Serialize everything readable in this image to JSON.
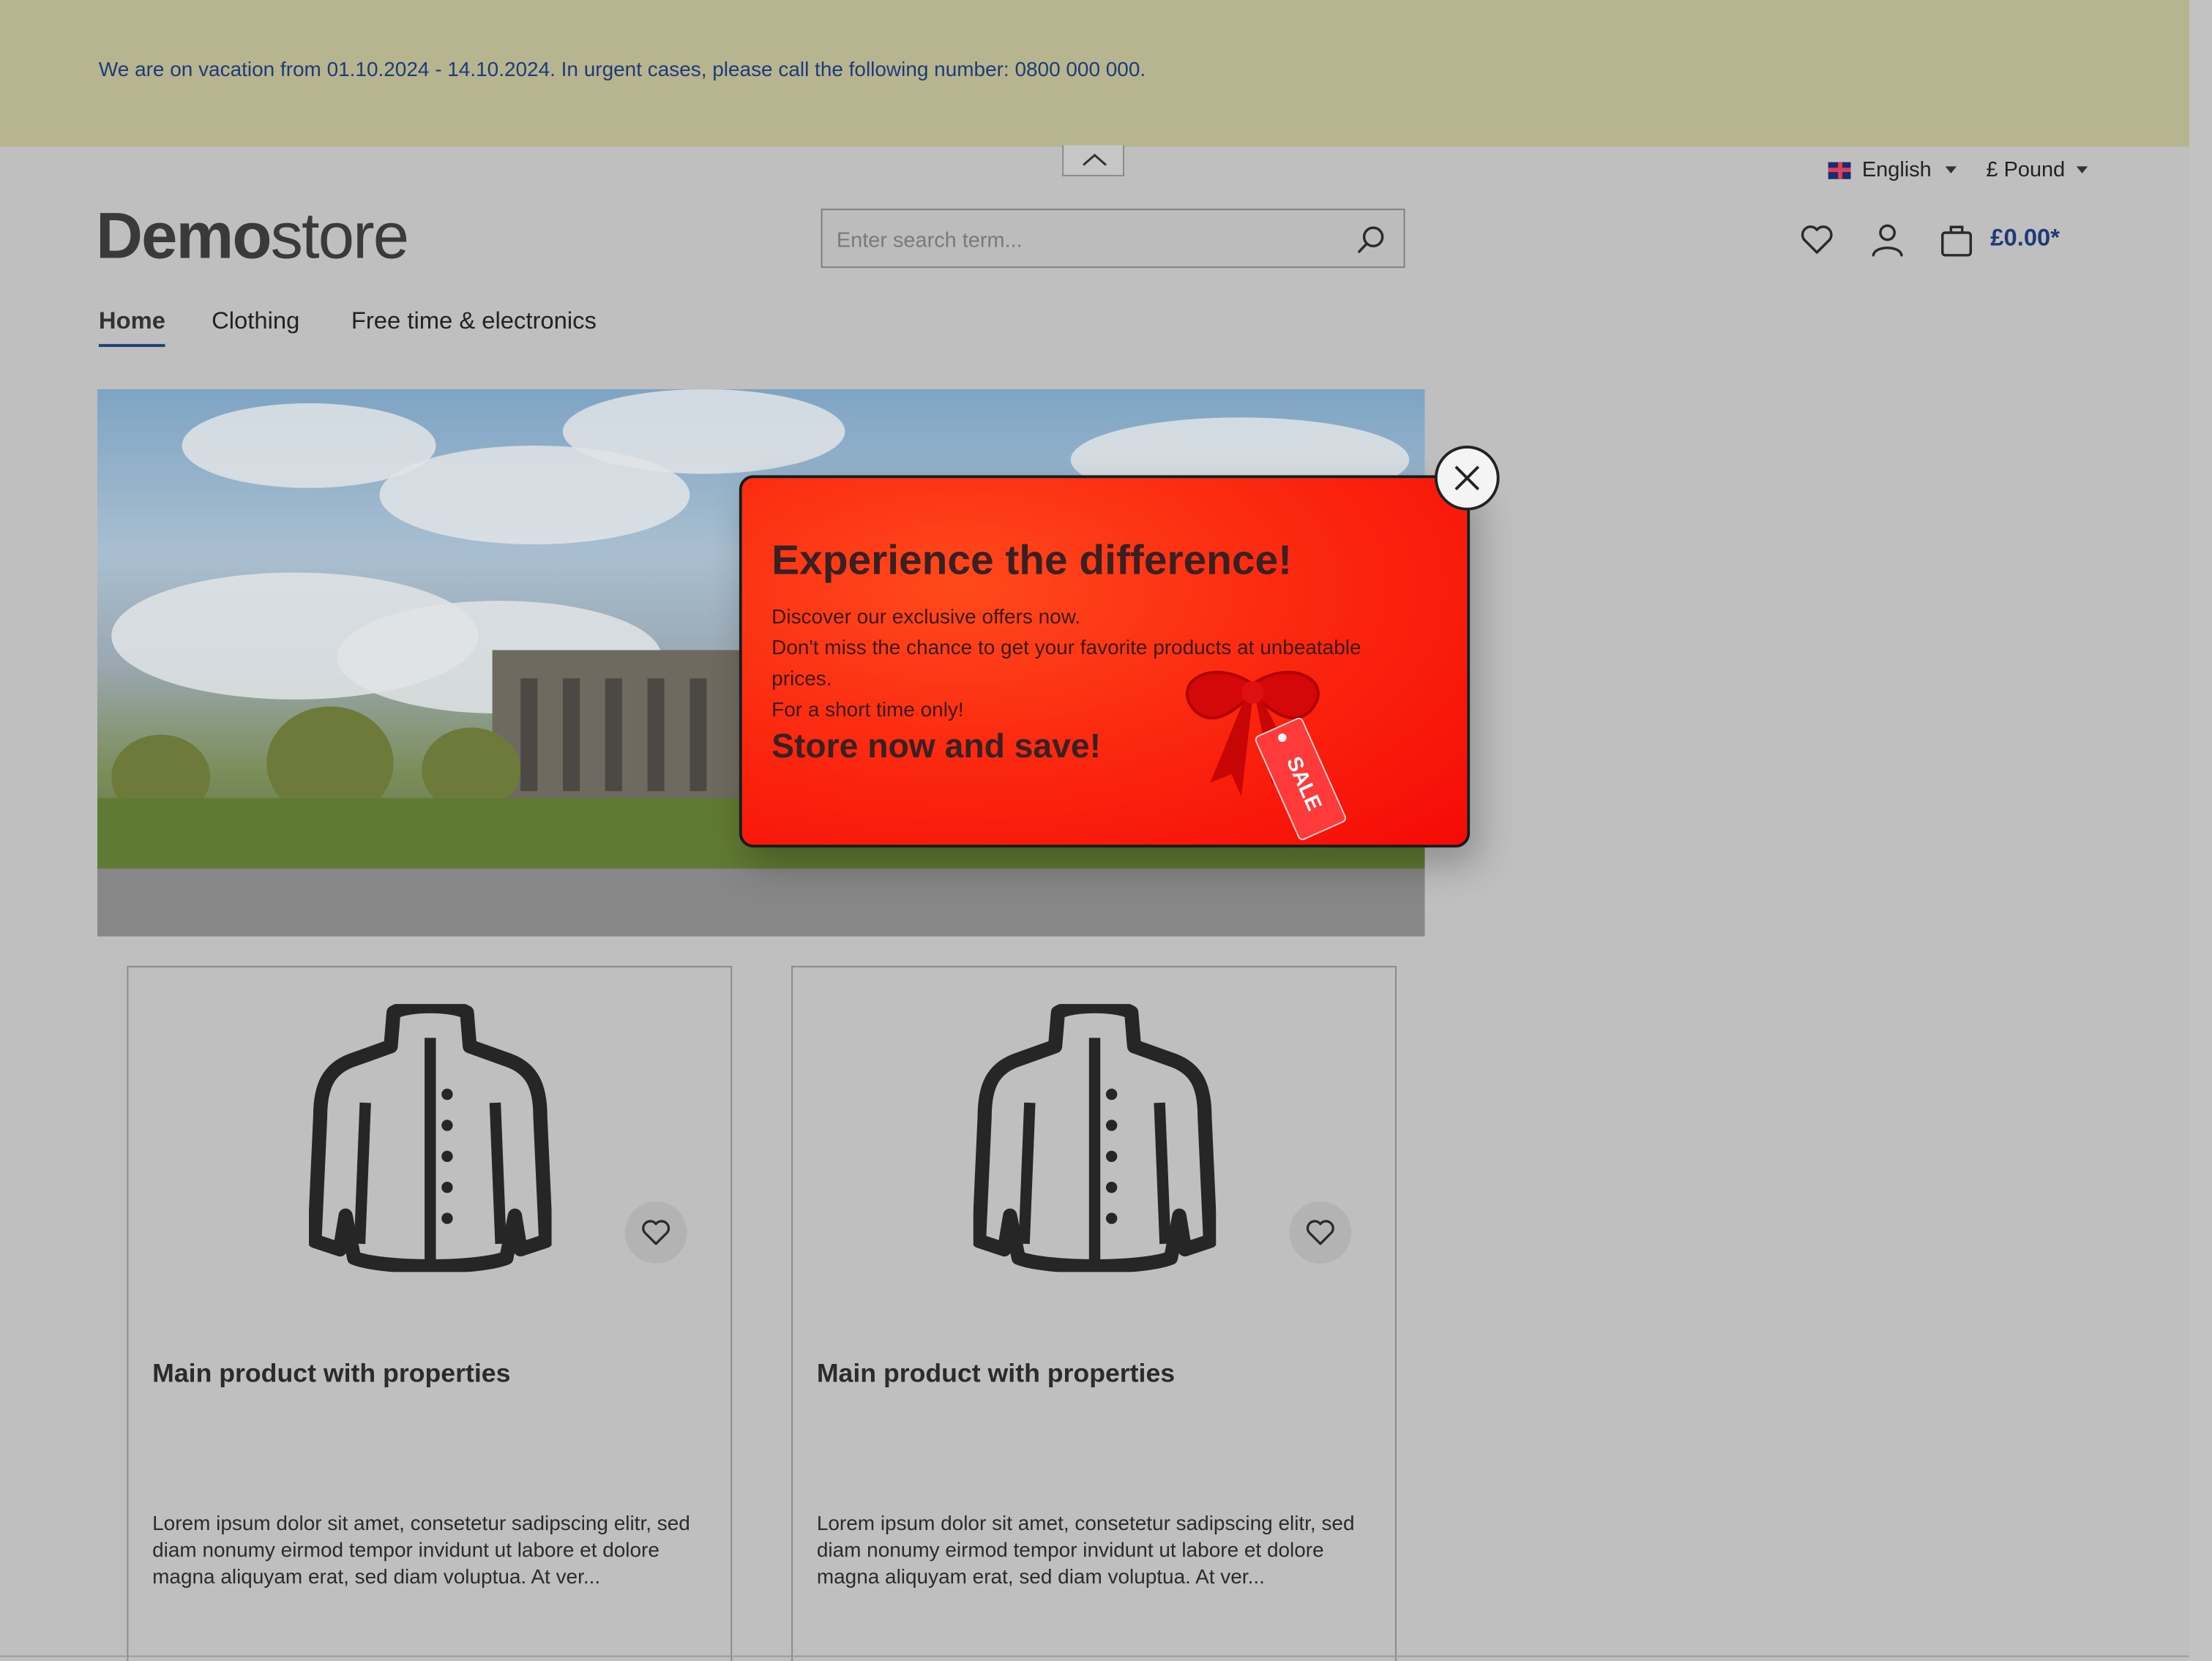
{
  "notice": {
    "text": "We are on vacation from 01.10.2024 - 14.10.2024. In urgent cases, please call the following number: 0800 000 000."
  },
  "topbar": {
    "language": "English",
    "currency": "£ Pound"
  },
  "header": {
    "logo_bold": "Demo",
    "logo_light": "store",
    "search_placeholder": "Enter search term...",
    "cart_total": "£0.00*"
  },
  "nav": {
    "items": [
      {
        "label": "Home",
        "active": true
      },
      {
        "label": "Clothing"
      },
      {
        "label": "Free time & electronics"
      }
    ]
  },
  "popup": {
    "title": "Experience the difference!",
    "lines": [
      "Discover our exclusive offers now.",
      "Don't miss the chance to get your favorite products at unbeatable",
      "prices.",
      "For a short time only!"
    ],
    "cta": "Store now and save!",
    "tag_text": "SALE"
  },
  "products": [
    {
      "title": "Main product with properties",
      "description": "Lorem ipsum dolor sit amet, consetetur sadipscing elitr, sed diam nonumy eirmod tempor invidunt ut labore et dolore magna aliquyam erat, sed diam voluptua. At ver..."
    },
    {
      "title": "Main product with properties",
      "description": "Lorem ipsum dolor sit amet, consetetur sadipscing elitr, sed diam nonumy eirmod tempor invidunt ut labore et dolore magna aliquyam erat, sed diam voluptua. At ver..."
    }
  ],
  "colors": {
    "notice_bg": "#b6b590",
    "accent": "#1f3b76",
    "popup_red": "#f50a05"
  }
}
